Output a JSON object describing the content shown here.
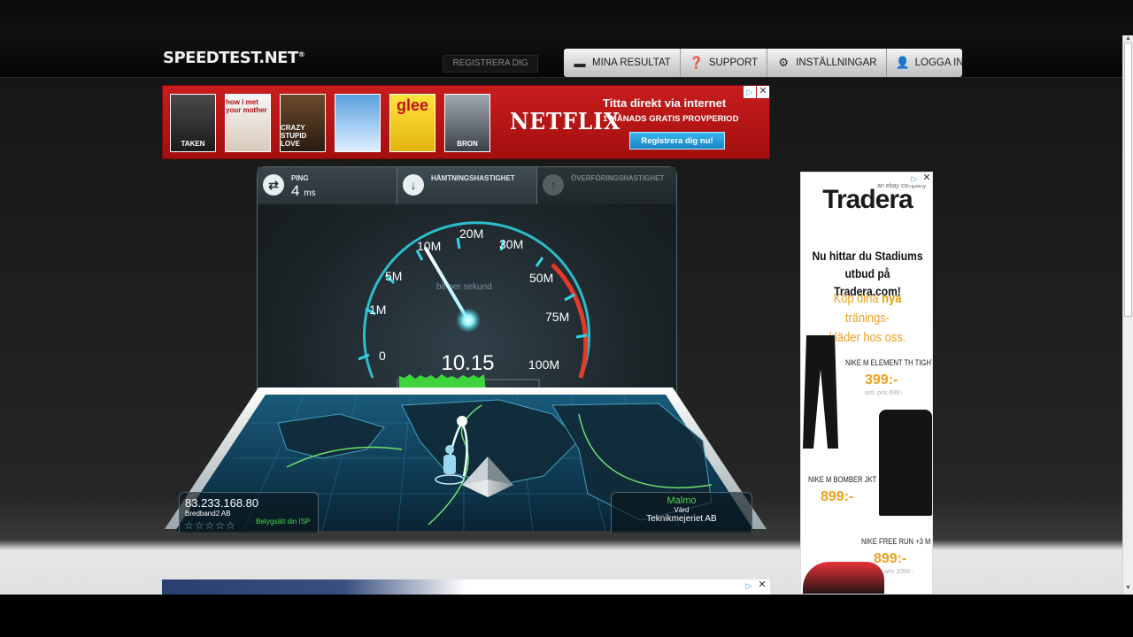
{
  "site": {
    "logo": "SPEEDTEST.NET",
    "logo_mark": "®",
    "register_label": "REGISTRERA DIG"
  },
  "nav": {
    "items": [
      {
        "label": "MINA RESULTAT",
        "icon": "folder-icon"
      },
      {
        "label": "SUPPORT",
        "icon": "help-icon"
      },
      {
        "label": "INSTÄLLNINGAR",
        "icon": "gear-icon"
      },
      {
        "label": "LOGGA IN",
        "icon": "person-icon"
      }
    ]
  },
  "netflix_ad": {
    "posters": [
      "TAKEN",
      "how i met your mother",
      "CRAZY STUPID LOVE",
      "",
      "glee",
      "BRON"
    ],
    "logo": "NETFLIX",
    "headline": "Titta direkt via internet",
    "subline": "1 MÅNADS GRATIS PROVPERIOD",
    "cta": "Registrera dig nu!"
  },
  "speedtest": {
    "ping_label": "PING",
    "ping_value": "4",
    "ping_unit": "ms",
    "download_label": "HÄMTNINGSHASTIGHET",
    "upload_label": "ÖVERFÖRINGSHASTIGHET",
    "gauge_unit": "bit per sekund",
    "current_speed": "10.15",
    "ticks": [
      "0",
      "1M",
      "5M",
      "10M",
      "20M",
      "30M",
      "50M",
      "75M",
      "100M"
    ],
    "ip_address": "83.233.168.80",
    "isp": "Bredband2 AB",
    "rate_isp": "Betygsätt din ISP",
    "server_city": "Malmo",
    "server_host_label": "Värd",
    "server_name": "Teknikmejeriet AB"
  },
  "tradera_ad": {
    "logo": "Tradera",
    "ebay_tag": "an ebay company",
    "headline_1": "Nu hittar du Stadiums",
    "headline_2": "utbud på Tradera.com!",
    "sub_1": "Köp dina ",
    "sub_bold": "nya",
    "sub_2": " tränings-",
    "sub_3": "kläder hos oss.",
    "products": [
      {
        "name": "NIKE M ELEMENT TH TIGHT",
        "price": "399:-",
        "ord": "ord. pris 699:-"
      },
      {
        "name": "NIKE M BOMBER JKT",
        "price": "899:-",
        "ord": ""
      },
      {
        "name": "NIKE FREE RUN +3 M",
        "price": "899:-",
        "ord": "ord. pris 1099:-"
      }
    ]
  },
  "colors": {
    "accent_green": "#4dd54d",
    "gauge_cyan": "#2fd6e6",
    "gauge_red": "#e53a2a",
    "netflix_red": "#c81d1d",
    "tradera_orange": "#f0a020"
  }
}
